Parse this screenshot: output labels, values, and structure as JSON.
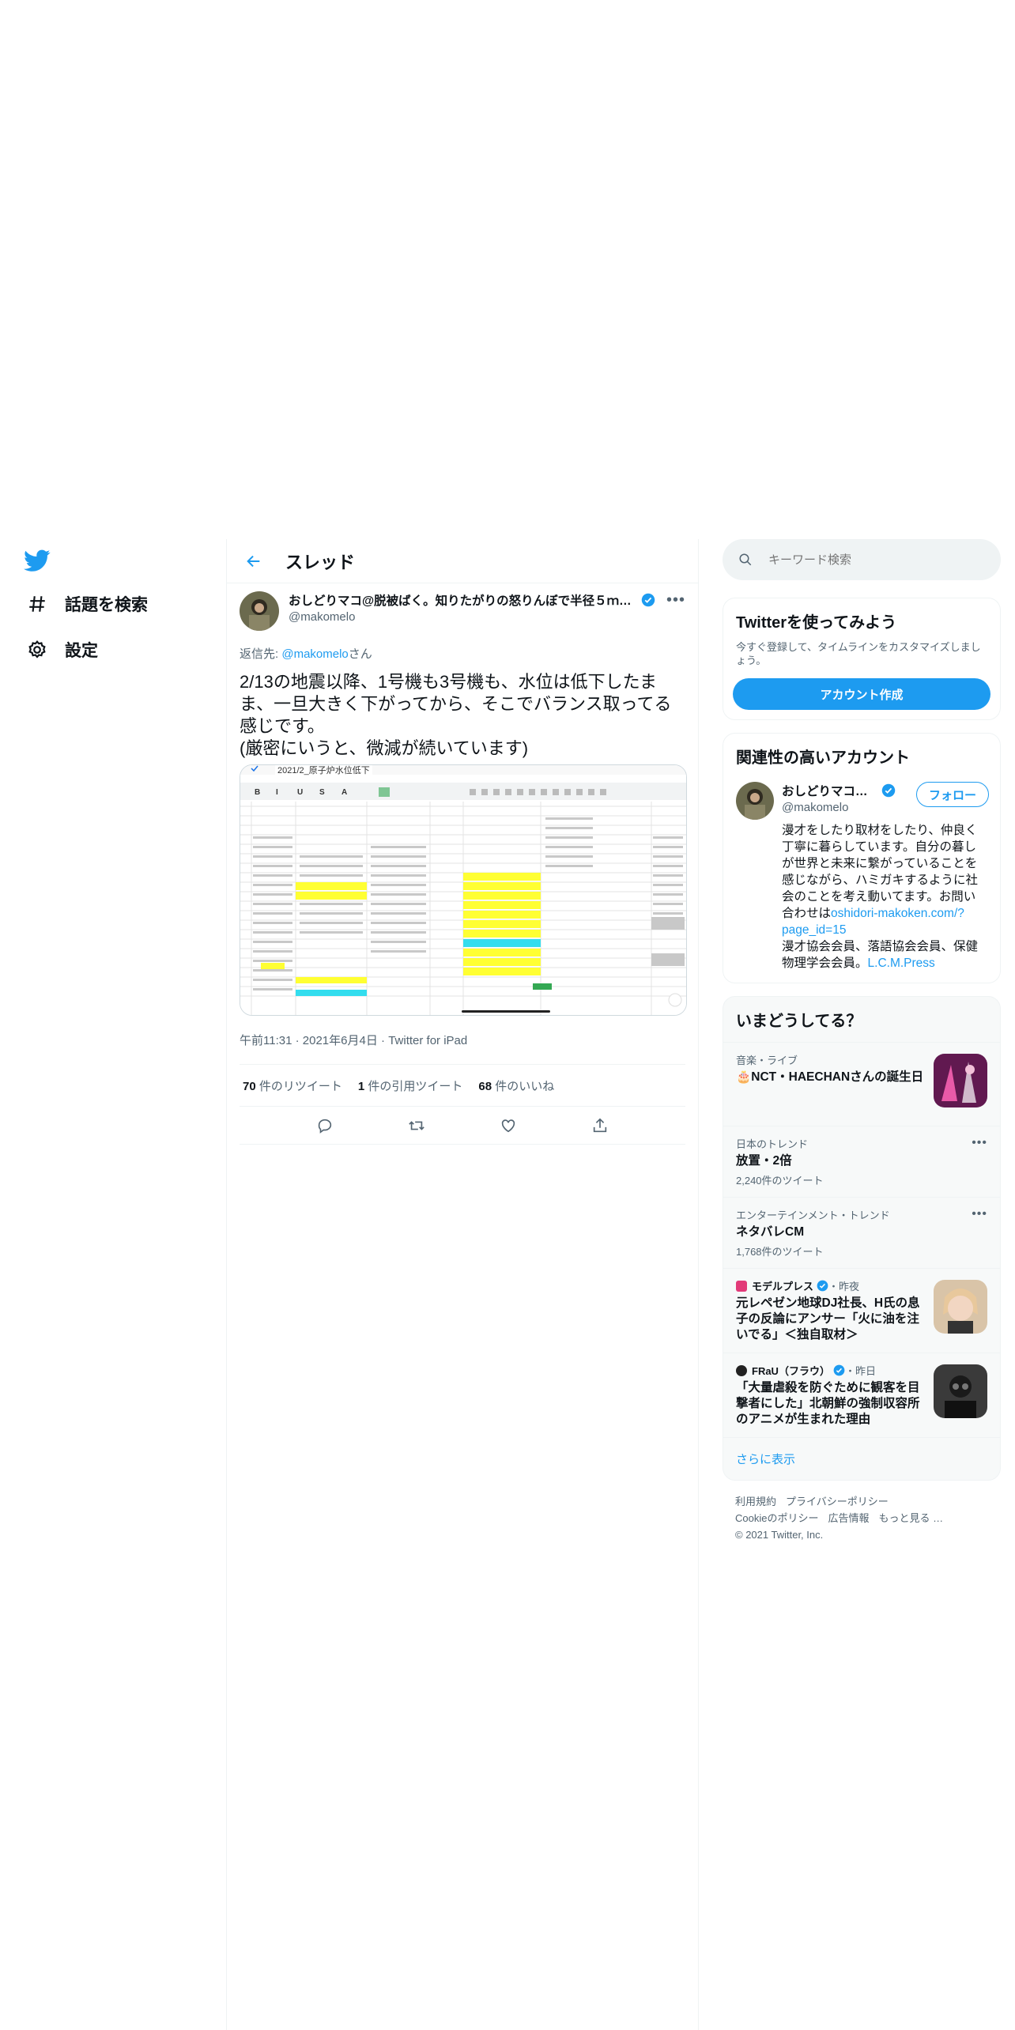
{
  "nav": {
    "items": [
      {
        "label": "話題を検索",
        "icon": "hashtag-icon"
      },
      {
        "label": "設定",
        "icon": "gear-icon"
      }
    ]
  },
  "header": {
    "title": "スレッド"
  },
  "tweet": {
    "display_name": "おしどりマコ@脱被ばく。知りたがりの怒りんぼで半径５ｍを…",
    "handle": "@makomelo",
    "reply_prefix": "返信先: ",
    "reply_handle": "@makomelo",
    "reply_suffix": "さん",
    "text": "2/13の地震以降、1号機も3号機も、水位は低下したまま、一旦大きく下がってから、そこでバランス取ってる感じです。\n(厳密にいうと、微減が続いています)",
    "media_title": "2021/2_原子炉水位低下",
    "time": "午前11:31",
    "date": "2021年6月4日",
    "client": "Twitter for iPad",
    "retweets_count": "70",
    "retweets_label": "件のリツイート",
    "quotes_count": "1",
    "quotes_label": "件の引用ツイート",
    "likes_count": "68",
    "likes_label": "件のいいね"
  },
  "search": {
    "placeholder": "キーワード検索"
  },
  "signup": {
    "title": "Twitterを使ってみよう",
    "subtitle": "今すぐ登録して、タイムラインをカスタマイズしましょう。",
    "button": "アカウント作成"
  },
  "related": {
    "title": "関連性の高いアカウント",
    "name": "おしどりマコ@...",
    "handle": "@makomelo",
    "follow": "フォロー",
    "bio_text1": "漫才をしたり取材をしたり、仲良く丁寧に暮らしています。自分の暮しが世界と未来に繋がっていることを感じながら、ハミガキするように社会のことを考え動いてます。お問い合わせは",
    "bio_link": "oshidori-makoken.com/?page_id=15",
    "bio_text2": "漫才協会会員、落語協会会員、保健物理学会会員。",
    "bio_link2": "L.C.M.Press"
  },
  "trends": {
    "title": "いまどうしてる？",
    "items": [
      {
        "category": "音楽・ライブ",
        "title": "🎂NCT・HAECHANさんの誕生日",
        "count": ""
      },
      {
        "category": "日本のトレンド",
        "title": "放置・2倍",
        "count": "2,240件のツイート"
      },
      {
        "category": "エンターテインメント・トレンド",
        "title": "ネタバレCM",
        "count": "1,768件のツイート"
      },
      {
        "source": "モデルプレス",
        "time": "・昨夜",
        "title": "元レペゼン地球DJ社長、H氏の息子の反論にアンサー「火に油を注いでる」＜独自取材＞"
      },
      {
        "source": "FRaU（フラウ）",
        "time": "・昨日",
        "title": "「大量虐殺を防ぐために観客を目撃者にした」北朝鮮の強制収容所のアニメが生まれた理由"
      }
    ],
    "show_more": "さらに表示"
  },
  "footer": {
    "line1": [
      "利用規約",
      "プライバシーポリシー"
    ],
    "line2": [
      "Cookieのポリシー",
      "広告情報",
      "もっと見る …"
    ],
    "copyright": "© 2021 Twitter, Inc."
  },
  "colors": {
    "accent": "#1d9bf0",
    "text": "#0f1419",
    "secondary": "#536471",
    "border": "#eff3f4"
  }
}
